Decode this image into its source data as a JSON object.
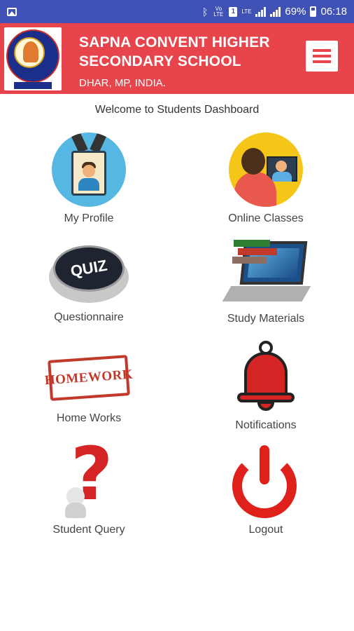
{
  "status_bar": {
    "battery_percent": "69%",
    "time": "06:18",
    "network_labels": [
      "Vo LTE",
      "LTE"
    ],
    "sim_badge": "1"
  },
  "header": {
    "school_name": "SAPNA CONVENT HIGHER SECONDARY SCHOOL",
    "location": "DHAR, MP, INDIA.",
    "background_color": "#e8444c"
  },
  "welcome_text": "Welcome to Students Dashboard",
  "menu": [
    {
      "label": "My Profile",
      "icon": "id-badge-icon"
    },
    {
      "label": "Online Classes",
      "icon": "video-call-icon"
    },
    {
      "label": "Questionnaire",
      "icon": "quiz-button-icon"
    },
    {
      "label": "Study Materials",
      "icon": "laptop-books-icon"
    },
    {
      "label": "Home Works",
      "icon": "homework-stamp-icon"
    },
    {
      "label": "Notifications",
      "icon": "bell-icon"
    },
    {
      "label": "Student Query",
      "icon": "question-mark-icon"
    },
    {
      "label": "Logout",
      "icon": "power-icon"
    }
  ],
  "tile_texts": {
    "quiz": "QUIZ",
    "homework": "HOMEWORK"
  }
}
